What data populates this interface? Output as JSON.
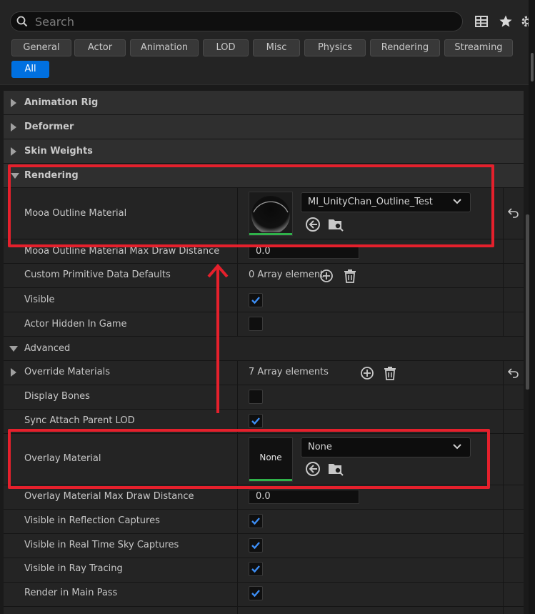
{
  "search": {
    "placeholder": "Search"
  },
  "filters": [
    "General",
    "Actor",
    "Animation",
    "LOD",
    "Misc",
    "Physics",
    "Rendering",
    "Streaming",
    "All"
  ],
  "active_filter": "All",
  "categories": {
    "animation_rig": "Animation Rig",
    "deformer": "Deformer",
    "skin_weights": "Skin Weights",
    "rendering": "Rendering",
    "advanced": "Advanced"
  },
  "props": {
    "outline_material": {
      "label": "Mooa Outline Material",
      "value": "MI_UnityChan_Outline_Test"
    },
    "outline_max_draw": {
      "label": "Mooa Outline Material Max Draw Distance",
      "value": "0.0"
    },
    "custom_primitive": {
      "label": "Custom Primitive Data Defaults",
      "value": "0 Array element"
    },
    "visible": {
      "label": "Visible",
      "checked": true
    },
    "actor_hidden": {
      "label": "Actor Hidden In Game",
      "checked": false
    },
    "override_materials": {
      "label": "Override Materials",
      "value": "7 Array elements"
    },
    "display_bones": {
      "label": "Display Bones",
      "checked": false
    },
    "sync_attach": {
      "label": "Sync Attach Parent LOD",
      "checked": true
    },
    "overlay_material": {
      "label": "Overlay Material",
      "value": "None",
      "thumb_text": "None"
    },
    "overlay_max_draw": {
      "label": "Overlay Material Max Draw Distance",
      "value": "0.0"
    },
    "vis_reflection": {
      "label": "Visible in Reflection Captures",
      "checked": true
    },
    "vis_sky": {
      "label": "Visible in Real Time Sky Captures",
      "checked": true
    },
    "vis_raytracing": {
      "label": "Visible in Ray Tracing",
      "checked": true
    },
    "render_main": {
      "label": "Render in Main Pass",
      "checked": true
    }
  },
  "colors": {
    "accent": "#0070e0",
    "highlight": "#e5202c",
    "check": "#3d8ef5",
    "thumb_bar": "#2fb24a"
  }
}
